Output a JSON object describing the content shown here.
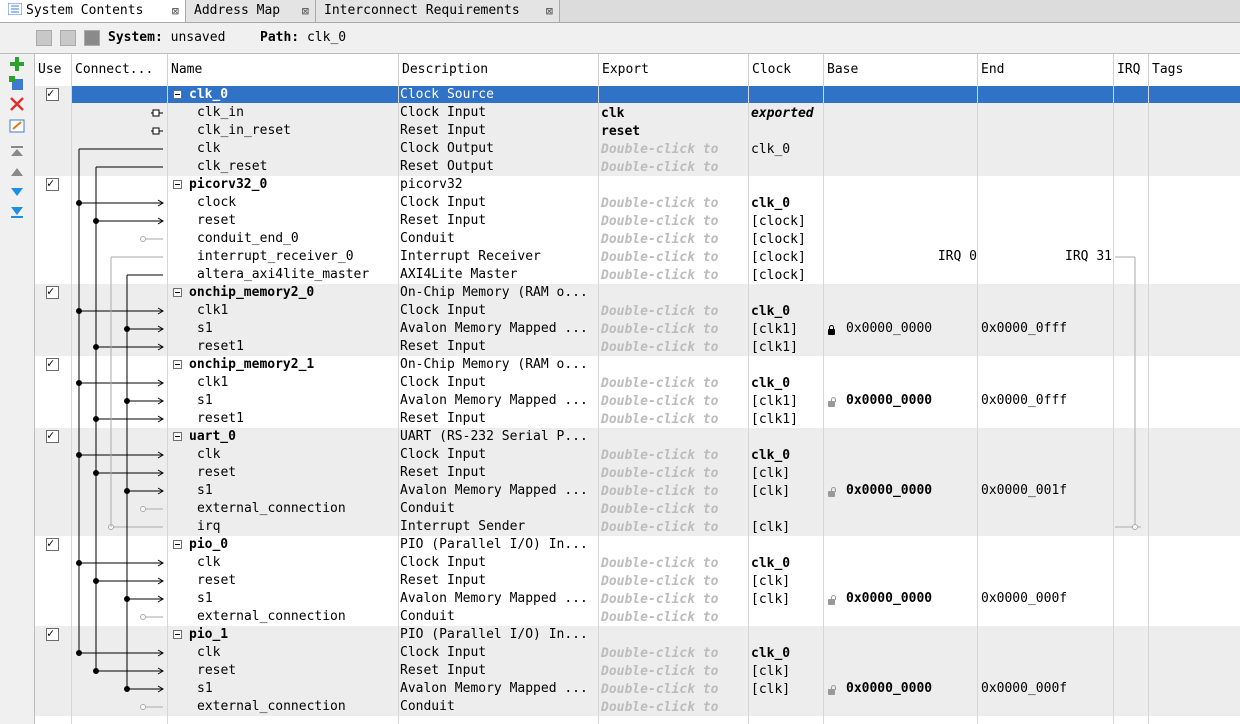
{
  "tabs": [
    {
      "label": "System Contents",
      "active": true
    },
    {
      "label": "Address Map",
      "active": false
    },
    {
      "label": "Interconnect Requirements",
      "active": false
    }
  ],
  "system_bar": {
    "system_label": "System:",
    "system_value": "unsaved",
    "path_label": "Path:",
    "path_value": "clk_0"
  },
  "left_toolbar": [
    "add-icon",
    "add-component-icon",
    "remove-icon",
    "edit-icon",
    "move-top-icon",
    "move-up-icon",
    "move-down-icon",
    "move-bottom-icon"
  ],
  "columns": [
    "Use",
    "Connect...",
    "Name",
    "Description",
    "Export",
    "Clock",
    "Base",
    "End",
    "IRQ",
    "Tags"
  ],
  "colors": {
    "selection": "#3072c5",
    "band_gray": "#ededed",
    "placeholder_text": "#bcbcbc"
  },
  "components": [
    {
      "name": "clk_0",
      "description": "Clock Source",
      "selected": true,
      "interfaces": [
        {
          "name": "clk_in",
          "description": "Clock Input",
          "export": "clk",
          "clock": "exported"
        },
        {
          "name": "clk_in_reset",
          "description": "Reset Input",
          "export": "reset",
          "clock": ""
        },
        {
          "name": "clk",
          "description": "Clock Output",
          "export": "Double-click to",
          "clock": "clk_0"
        },
        {
          "name": "clk_reset",
          "description": "Reset Output",
          "export": "Double-click to",
          "clock": ""
        }
      ]
    },
    {
      "name": "picorv32_0",
      "description": "picorv32",
      "selected": false,
      "interfaces": [
        {
          "name": "clock",
          "description": "Clock Input",
          "export": "Double-click to",
          "clock": "clk_0"
        },
        {
          "name": "reset",
          "description": "Reset Input",
          "export": "Double-click to",
          "clock": "[clock]"
        },
        {
          "name": "conduit_end_0",
          "description": "Conduit",
          "export": "Double-click to",
          "clock": "[clock]"
        },
        {
          "name": "interrupt_receiver_0",
          "description": "Interrupt Receiver",
          "export": "Double-click to",
          "clock": "[clock]",
          "base": "IRQ 0",
          "end": "IRQ 31"
        },
        {
          "name": "altera_axi4lite_master",
          "description": "AXI4Lite Master",
          "export": "Double-click to",
          "clock": "[clock]"
        }
      ]
    },
    {
      "name": "onchip_memory2_0",
      "description": "On-Chip Memory (RAM o...",
      "selected": false,
      "interfaces": [
        {
          "name": "clk1",
          "description": "Clock Input",
          "export": "Double-click to",
          "clock": "clk_0"
        },
        {
          "name": "s1",
          "description": "Avalon Memory Mapped ...",
          "export": "Double-click to",
          "clock": "[clk1]",
          "base": "0x0000_0000",
          "end": "0x0000_0fff",
          "locked": true,
          "base_bold": false
        },
        {
          "name": "reset1",
          "description": "Reset Input",
          "export": "Double-click to",
          "clock": "[clk1]"
        }
      ]
    },
    {
      "name": "onchip_memory2_1",
      "description": "On-Chip Memory (RAM o...",
      "selected": false,
      "interfaces": [
        {
          "name": "clk1",
          "description": "Clock Input",
          "export": "Double-click to",
          "clock": "clk_0"
        },
        {
          "name": "s1",
          "description": "Avalon Memory Mapped ...",
          "export": "Double-click to",
          "clock": "[clk1]",
          "base": "0x0000_0000",
          "end": "0x0000_0fff",
          "locked": false,
          "base_bold": true
        },
        {
          "name": "reset1",
          "description": "Reset Input",
          "export": "Double-click to",
          "clock": "[clk1]"
        }
      ]
    },
    {
      "name": "uart_0",
      "description": "UART (RS-232 Serial P...",
      "selected": false,
      "interfaces": [
        {
          "name": "clk",
          "description": "Clock Input",
          "export": "Double-click to",
          "clock": "clk_0"
        },
        {
          "name": "reset",
          "description": "Reset Input",
          "export": "Double-click to",
          "clock": "[clk]"
        },
        {
          "name": "s1",
          "description": "Avalon Memory Mapped ...",
          "export": "Double-click to",
          "clock": "[clk]",
          "base": "0x0000_0000",
          "end": "0x0000_001f",
          "locked": false,
          "base_bold": true
        },
        {
          "name": "external_connection",
          "description": "Conduit",
          "export": "Double-click to",
          "clock": ""
        },
        {
          "name": "irq",
          "description": "Interrupt Sender",
          "export": "Double-click to",
          "clock": "[clk]"
        }
      ]
    },
    {
      "name": "pio_0",
      "description": "PIO (Parallel I/O) In...",
      "selected": false,
      "interfaces": [
        {
          "name": "clk",
          "description": "Clock Input",
          "export": "Double-click to",
          "clock": "clk_0"
        },
        {
          "name": "reset",
          "description": "Reset Input",
          "export": "Double-click to",
          "clock": "[clk]"
        },
        {
          "name": "s1",
          "description": "Avalon Memory Mapped ...",
          "export": "Double-click to",
          "clock": "[clk]",
          "base": "0x0000_0000",
          "end": "0x0000_000f",
          "locked": false,
          "base_bold": true
        },
        {
          "name": "external_connection",
          "description": "Conduit",
          "export": "Double-click to",
          "clock": ""
        }
      ]
    },
    {
      "name": "pio_1",
      "description": "PIO (Parallel I/O) In...",
      "selected": false,
      "interfaces": [
        {
          "name": "clk",
          "description": "Clock Input",
          "export": "Double-click to",
          "clock": "clk_0"
        },
        {
          "name": "reset",
          "description": "Reset Input",
          "export": "Double-click to",
          "clock": "[clk]"
        },
        {
          "name": "s1",
          "description": "Avalon Memory Mapped ...",
          "export": "Double-click to",
          "clock": "[clk]",
          "base": "0x0000_0000",
          "end": "0x0000_000f",
          "locked": false,
          "base_bold": true
        },
        {
          "name": "external_connection",
          "description": "Conduit",
          "export": "Double-click to",
          "clock": ""
        }
      ]
    }
  ]
}
